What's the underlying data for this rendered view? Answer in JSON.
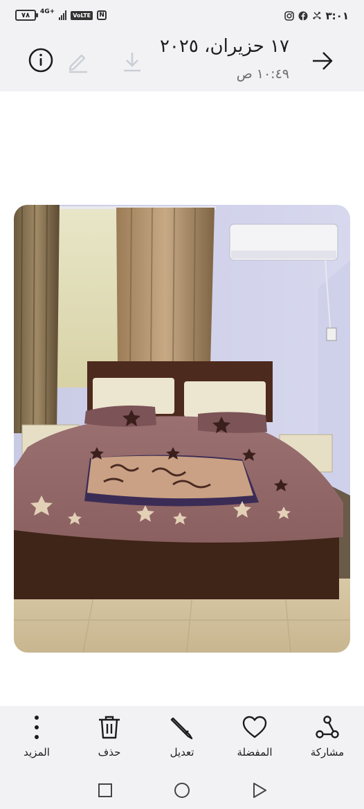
{
  "status_bar": {
    "battery": "٧٨",
    "network": "4G+",
    "volte": "VoLTE",
    "nfc": "N",
    "time": "٣:٠١"
  },
  "header": {
    "date": "١٧ حزيران، ٢٠٢٥",
    "time": "١٠:٤٩ ص"
  },
  "actions": {
    "share": "مشاركة",
    "favorite": "المفضلة",
    "edit": "تعديل",
    "delete": "حذف",
    "more": "المزيد"
  },
  "icons": {
    "info": "info-icon",
    "back": "arrow-right-icon",
    "edit": "pencil-icon",
    "download": "download-icon",
    "share": "share-icon",
    "favorite": "heart-icon",
    "delete": "trash-icon",
    "more": "more-vertical-icon"
  },
  "colors": {
    "bar_background": "#f2f2f4",
    "text": "#1c1c1c",
    "subtle_text": "#6b6b6b"
  }
}
